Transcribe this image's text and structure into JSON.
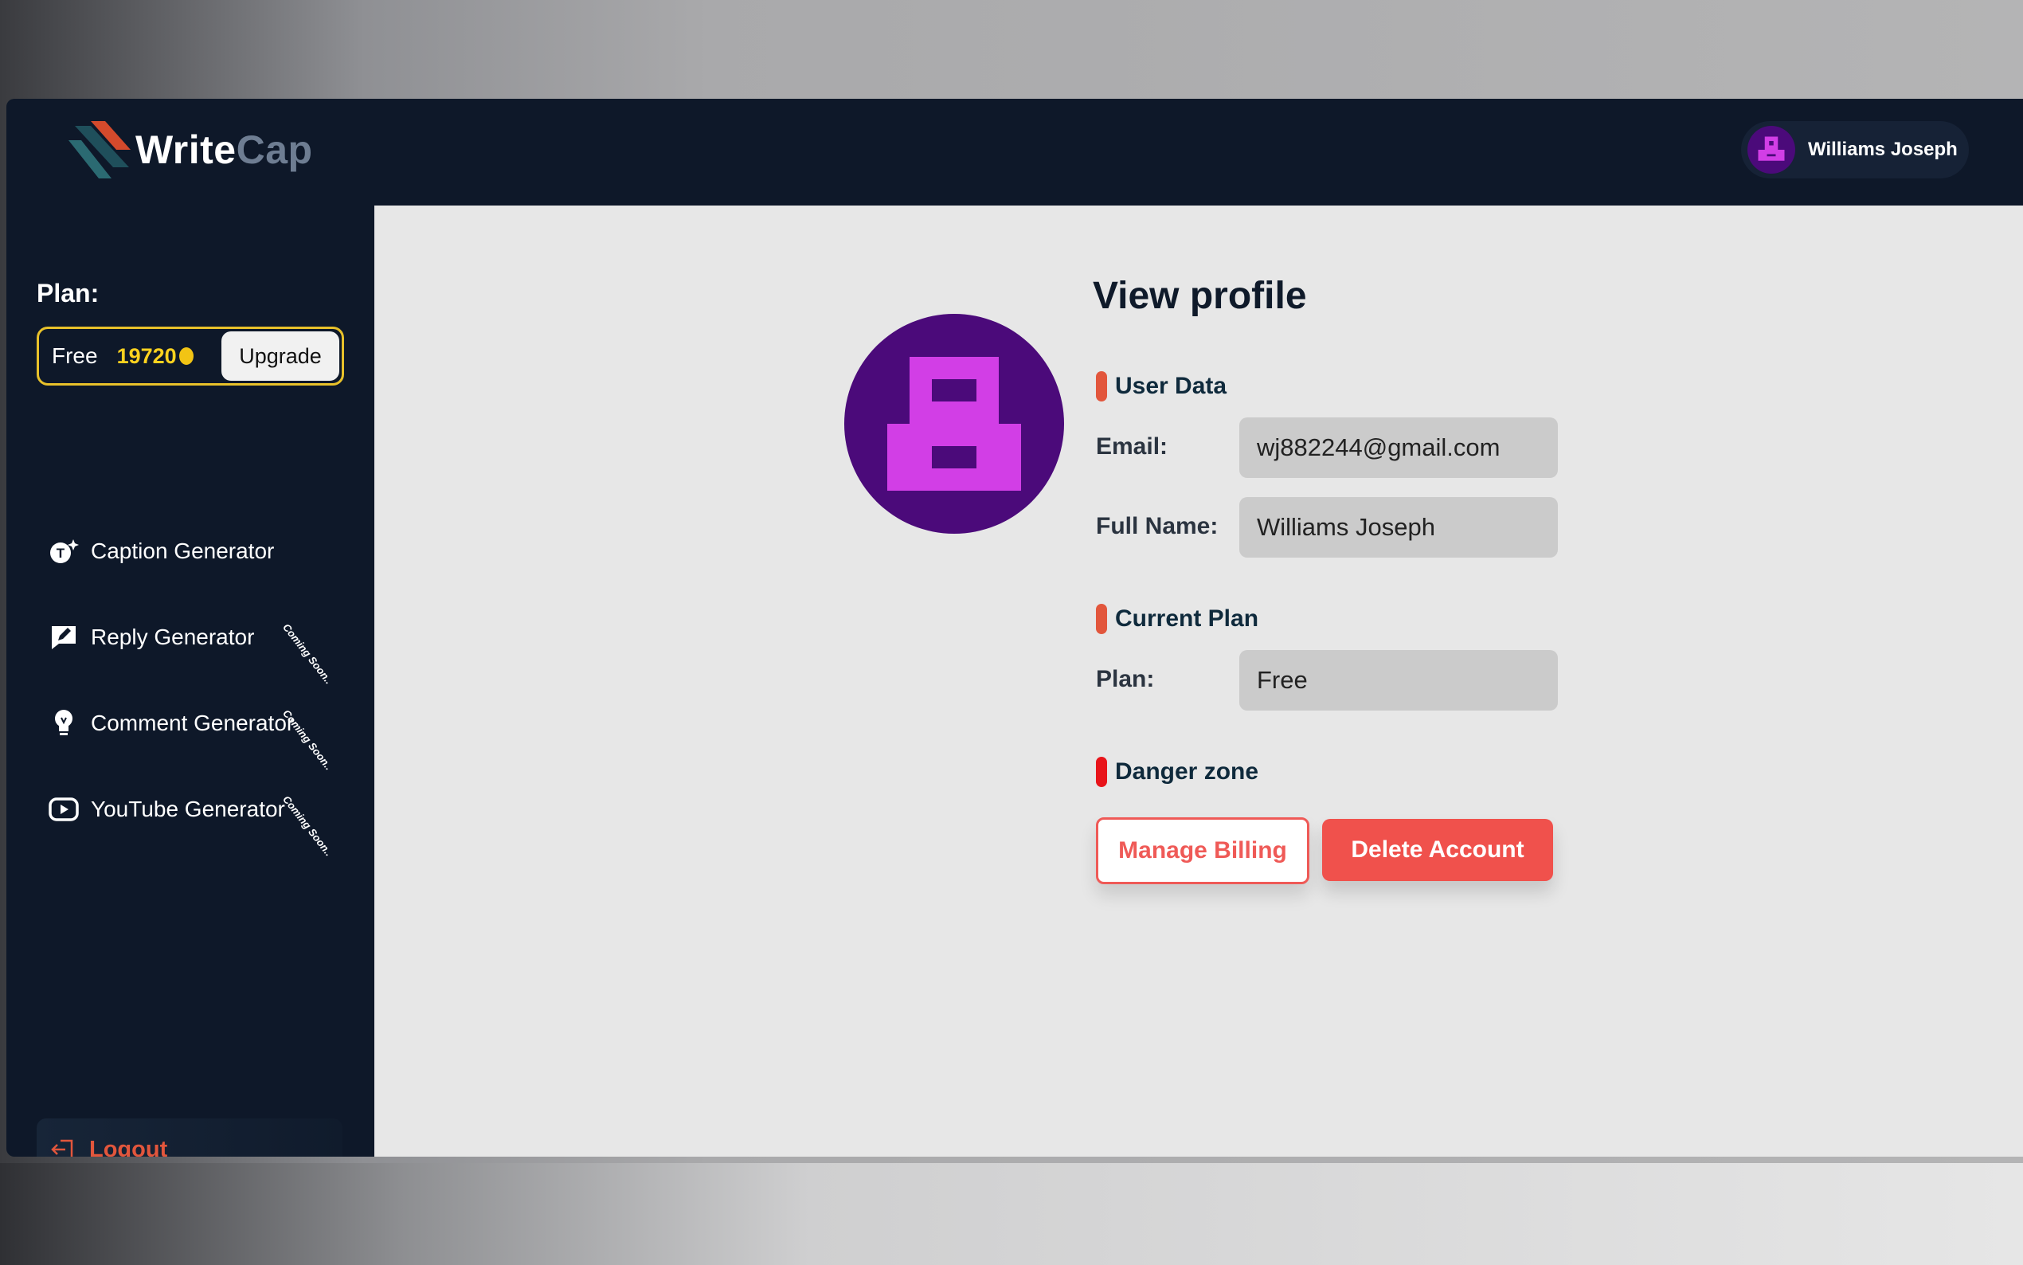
{
  "app": {
    "name_part1": "Write",
    "name_part2": "Cap"
  },
  "user": {
    "name": "Williams Joseph",
    "avatar_colors": {
      "background": "#4b0a7a",
      "foreground": "#d23ee6"
    }
  },
  "sidebar": {
    "plan_label": "Plan:",
    "plan_name": "Free",
    "credits": "19720",
    "upgrade_label": "Upgrade",
    "items": [
      {
        "label": "Caption Generator",
        "icon": "caption-sparkle-icon",
        "badge": ""
      },
      {
        "label": "Reply Generator",
        "icon": "edit-reply-icon",
        "badge": "Coming Soon.."
      },
      {
        "label": "Comment Generator",
        "icon": "lightbulb-icon",
        "badge": "Coming Soon.."
      },
      {
        "label": "YouTube Generator",
        "icon": "youtube-icon",
        "badge": "Coming Soon.."
      }
    ],
    "logout_label": "Logout"
  },
  "profile": {
    "title": "View profile",
    "sections": {
      "user_data": "User Data",
      "current_plan": "Current Plan",
      "danger_zone": "Danger zone"
    },
    "fields": {
      "email_label": "Email:",
      "email_value": "wj882244@gmail.com",
      "fullname_label": "Full Name:",
      "fullname_value": "Williams Joseph",
      "plan_label": "Plan:",
      "plan_value": "Free"
    },
    "buttons": {
      "manage_billing": "Manage Billing",
      "delete_account": "Delete Account"
    }
  },
  "colors": {
    "sidebar_bg": "#0e1829",
    "accent_orange": "#e2563c",
    "danger_red": "#f0514c",
    "credits_yellow": "#ffd21f"
  }
}
